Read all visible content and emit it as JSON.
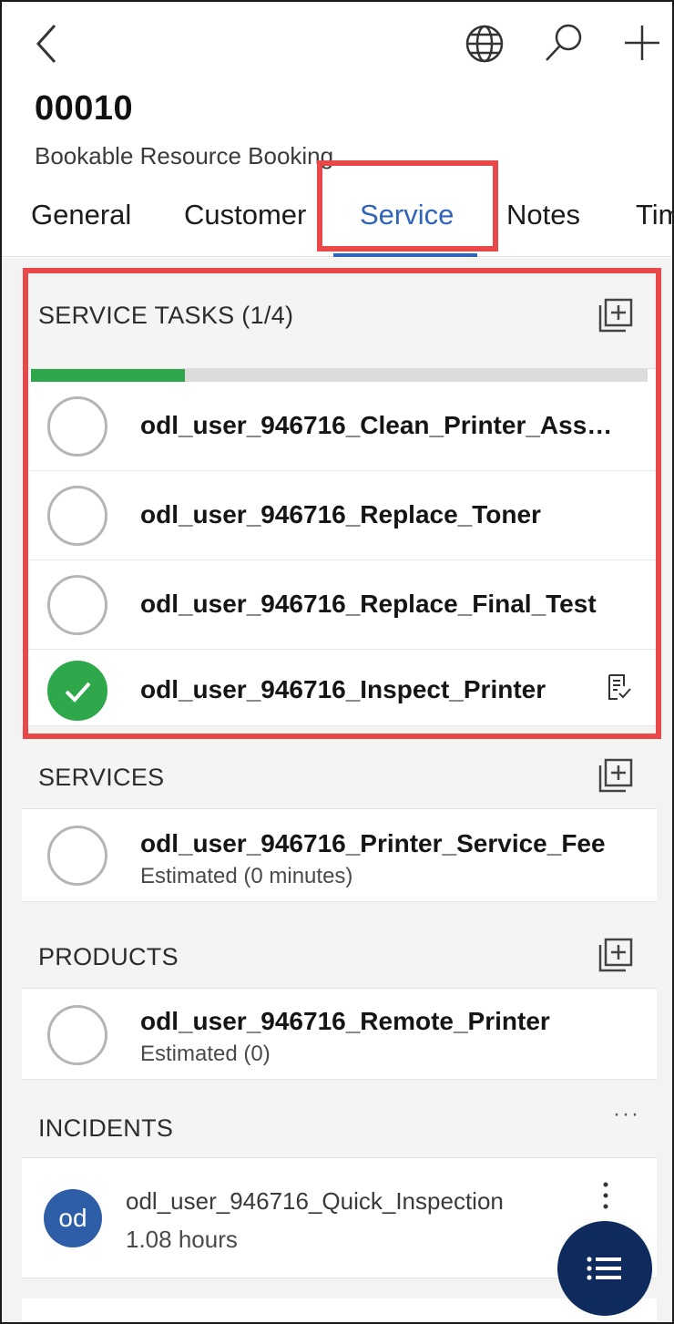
{
  "header": {
    "record_id": "00010",
    "entity": "Bookable Resource Booking",
    "icons": [
      "back-arrow-icon",
      "globe-icon",
      "search-icon",
      "plus-icon"
    ]
  },
  "tabs": [
    {
      "label": "General",
      "active": false
    },
    {
      "label": "Customer",
      "active": false
    },
    {
      "label": "Service",
      "active": true
    },
    {
      "label": "Notes",
      "active": false
    },
    {
      "label": "Tim",
      "active": false
    }
  ],
  "service_tasks": {
    "title": "SERVICE TASKS (1/4)",
    "progress_fraction": 0.25,
    "items": [
      {
        "name": "odl_user_946716_Clean_Printer_Assem...",
        "completed": false
      },
      {
        "name": "odl_user_946716_Replace_Toner",
        "completed": false
      },
      {
        "name": "odl_user_946716_Replace_Final_Test",
        "completed": false
      },
      {
        "name": "odl_user_946716_Inspect_Printer",
        "completed": true,
        "icon": "checklist-icon"
      }
    ]
  },
  "services": {
    "title": "SERVICES",
    "items": [
      {
        "name": "odl_user_946716_Printer_Service_Fee",
        "detail": "Estimated (0 minutes)"
      }
    ]
  },
  "products": {
    "title": "PRODUCTS",
    "items": [
      {
        "name": "odl_user_946716_Remote_Printer",
        "detail": "Estimated (0)"
      }
    ]
  },
  "incidents": {
    "title": "INCIDENTS",
    "more_label": "···",
    "items": [
      {
        "avatar": "od",
        "name": "odl_user_946716_Quick_Inspection",
        "detail": "1.08 hours"
      }
    ]
  },
  "colors": {
    "accent": "#2f64b8",
    "complete": "#2ea84a",
    "highlight": "#e94848",
    "fab": "#0f2b5e",
    "avatar": "#2f5ea8"
  }
}
